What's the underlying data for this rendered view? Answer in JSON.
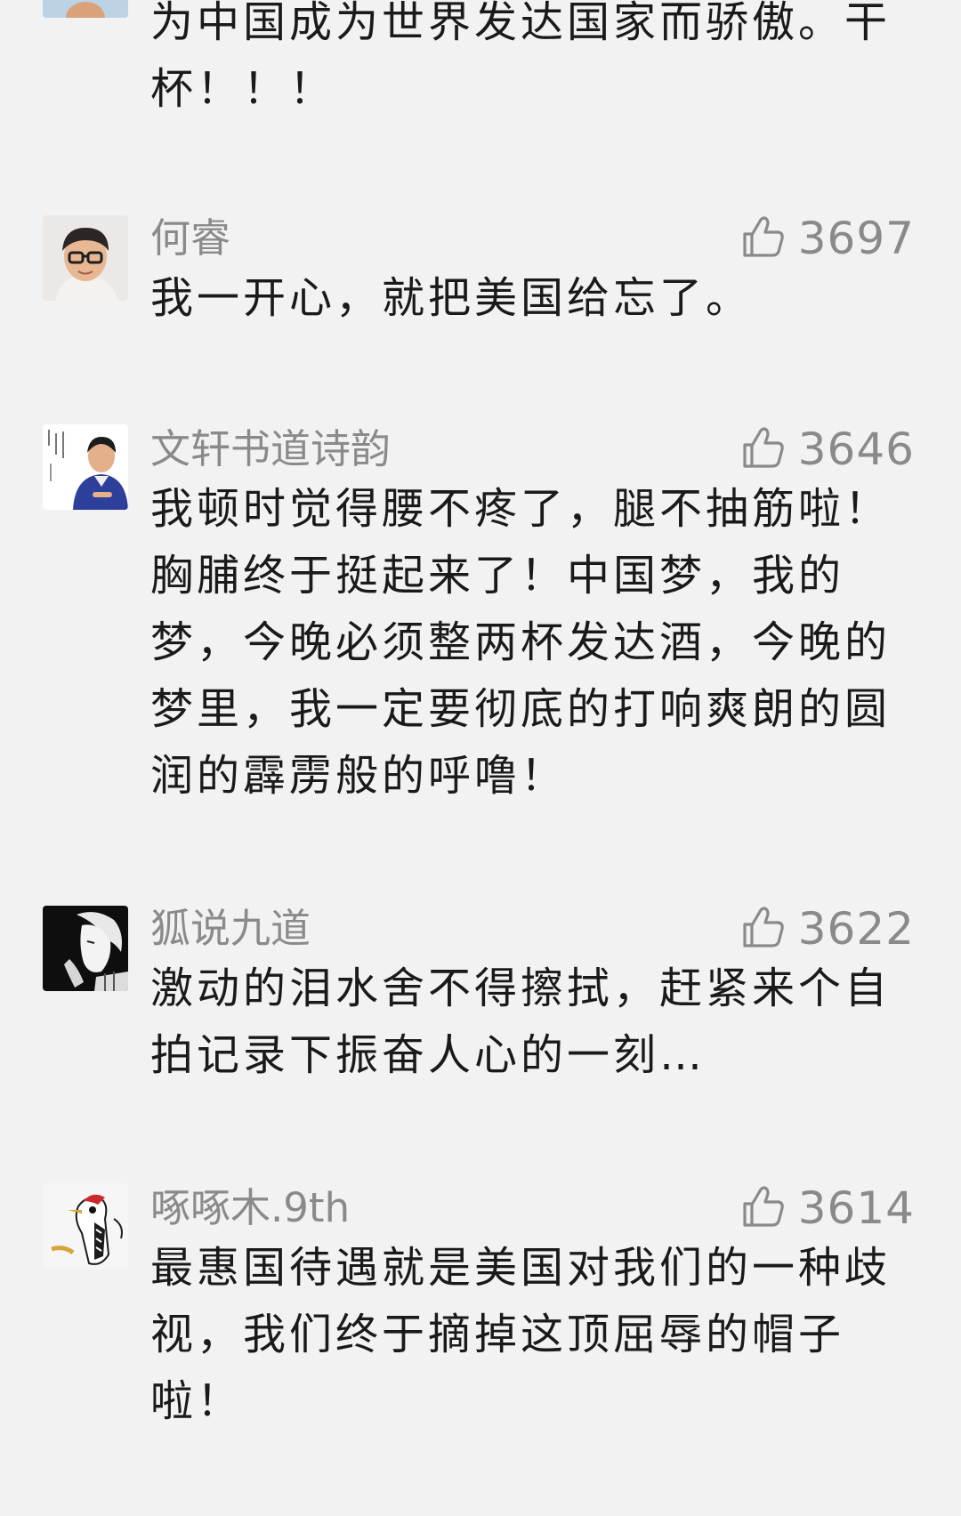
{
  "comments": [
    {
      "username": "",
      "text": "为中国成为世界发达国家而骄傲。干杯！！！",
      "likes": ""
    },
    {
      "username": "何睿",
      "text": "我一开心，就把美国给忘了。",
      "likes": "3697"
    },
    {
      "username": "文轩书道诗韵",
      "text": "我顿时觉得腰不疼了，腿不抽筋啦！胸脯终于挺起来了！中国梦，我的梦，今晚必须整两杯发达酒，今晚的梦里，我一定要彻底的打响爽朗的圆润的霹雳般的呼噜！",
      "likes": "3646",
      "avatar_text": "文轩书道诗韵"
    },
    {
      "username": "狐说九道",
      "text": "激动的泪水舍不得擦拭，赶紧来个自拍记录下振奋人心的一刻…",
      "likes": "3622"
    },
    {
      "username": "啄啄木.9th",
      "text": "最惠国待遇就是美国对我们的一种歧视，我们终于摘掉这顶屈辱的帽子啦！",
      "likes": "3614"
    }
  ],
  "icons": {
    "like": "thumbs-up-icon"
  }
}
